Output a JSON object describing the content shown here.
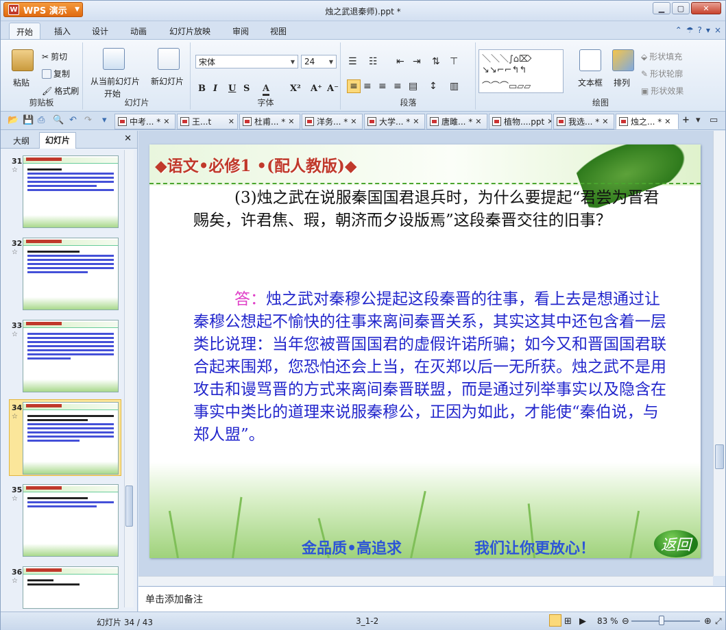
{
  "window": {
    "app_button": "WPS 演示",
    "title": "烛之武退秦师).ppt *"
  },
  "ribbon_tabs": [
    "开始",
    "插入",
    "设计",
    "动画",
    "幻灯片放映",
    "审阅",
    "视图"
  ],
  "ribbon": {
    "clipboard": {
      "paste": "粘贴",
      "cut": "剪切",
      "copy": "复制",
      "format_painter": "格式刷",
      "label": "剪贴板"
    },
    "slides": {
      "from_current": "从当前幻灯片",
      "from_current2": "开始",
      "new_slide": "新幻灯片",
      "label": "幻灯片"
    },
    "font": {
      "name": "宋体",
      "size": "24",
      "label": "字体"
    },
    "paragraph": {
      "label": "段落"
    },
    "drawing": {
      "textbox": "文本框",
      "arrange": "排列",
      "fill": "形状填充",
      "outline": "形状轮廓",
      "effect": "形状效果",
      "label": "绘图"
    }
  },
  "doc_tabs": [
    {
      "label": "中考... *"
    },
    {
      "label": "王...t"
    },
    {
      "label": "杜甫... *"
    },
    {
      "label": "洋务... *"
    },
    {
      "label": "大学... *"
    },
    {
      "label": "唐雎... *"
    },
    {
      "label": "植物....ppt"
    },
    {
      "label": "我选... *"
    },
    {
      "label": "烛之... *"
    }
  ],
  "left_pane": {
    "tab_outline": "大纲",
    "tab_slides": "幻灯片",
    "thumbnails": [
      {
        "num": "31"
      },
      {
        "num": "32"
      },
      {
        "num": "33"
      },
      {
        "num": "34"
      },
      {
        "num": "35"
      },
      {
        "num": "36"
      }
    ],
    "selected": "34"
  },
  "slide": {
    "title": "◆语文•必修1 •(配人教版)◆",
    "question": "(3)烛之武在说服秦国国君退兵时，为什么要提起“君尝为晋君赐矣，许君焦、瑕，朝济而夕设版焉”这段秦晋交往的旧事？",
    "answer_label": "答：",
    "answer": "烛之武对秦穆公提起这段秦晋的往事，看上去是想通过让秦穆公想起不愉快的往事来离间秦晋关系，其实这其中还包含着一层类比说理：当年您被晋国国君的虚假许诺所骗；如今又和晋国国君联合起来围郑，您恐怕还会上当，在灭郑以后一无所获。烛之武不是用攻击和谩骂晋的方式来离间秦晋联盟，而是通过列举事实以及隐含在事实中类比的道理来说服秦穆公，正因为如此，才能使“秦伯说，与郑人盟”。",
    "footer_left": "金品质•高追求",
    "footer_right": "我们让你更放心！",
    "back_button": "返回"
  },
  "notes_placeholder": "单击添加备注",
  "status": {
    "slide_count": "幻灯片 34 / 43",
    "template": "3_1-2",
    "zoom": "83 %"
  }
}
